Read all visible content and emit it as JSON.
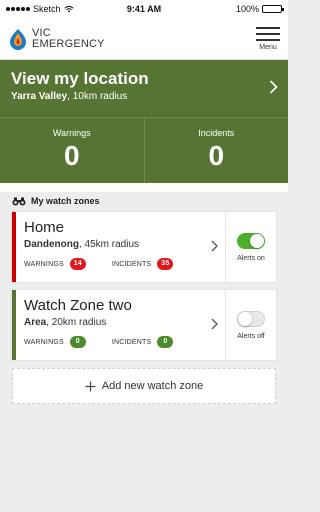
{
  "status_bar": {
    "carrier": "Sketch",
    "time": "9:41 AM",
    "battery": "100%",
    "battery_level": 1.0
  },
  "header": {
    "brand_line1": "VIC",
    "brand_line2": "EMERGENCY",
    "menu_label": "Menu"
  },
  "location": {
    "title": "View my location",
    "place": "Yarra Valley",
    "radius": ", 10km radius"
  },
  "counts": {
    "warnings_label": "Warnings",
    "warnings_value": "0",
    "incidents_label": "Incidents",
    "incidents_value": "0"
  },
  "zones_header": "My watch zones",
  "zones": [
    {
      "name": "Home",
      "place": "Dandenong",
      "radius": ", 45km radius",
      "warnings_label": "WARNINGS",
      "warnings_count": "14",
      "incidents_label": "INCIDENTS",
      "incidents_count": "35",
      "alerts_label": "Alerts on",
      "alerts_on": true
    },
    {
      "name": "Watch Zone two",
      "place": "Area",
      "radius": ", 20km radius",
      "warnings_label": "WARNINGS",
      "warnings_count": "0",
      "incidents_label": "INCIDENTS",
      "incidents_count": "0",
      "alerts_label": "Alerts off",
      "alerts_on": false
    }
  ],
  "add_zone_label": "Add new watch zone",
  "colors": {
    "brand_green": "#567532",
    "alert_red": "#e0181e",
    "toggle_on": "#4caf2a"
  }
}
